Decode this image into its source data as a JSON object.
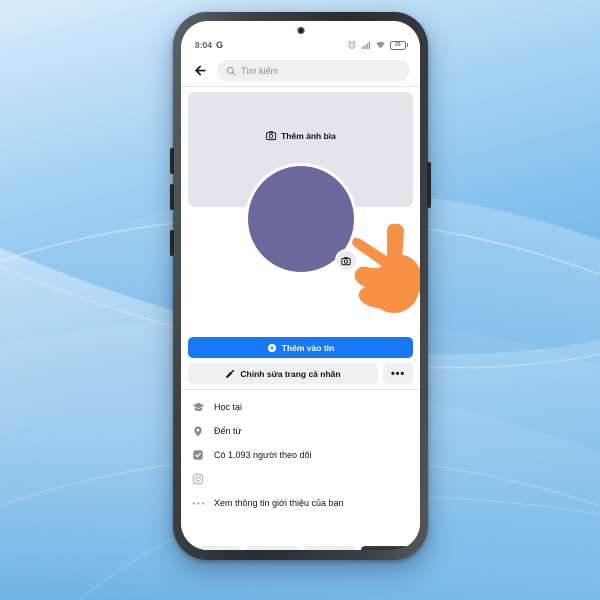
{
  "scene": {
    "description": "Android phone mockup on light blue abstract wallpaper showing a Facebook profile setup screen in Vietnamese",
    "wallpaper_colors": [
      "#cfe6fa",
      "#8ec5ef",
      "#63b0e8",
      "#4aa3e4"
    ]
  },
  "statusbar": {
    "time": "8:04",
    "network_label": "G",
    "icons": [
      "alarm-icon",
      "signal-icon",
      "wifi-icon",
      "battery-icon"
    ],
    "battery_level": "25"
  },
  "search": {
    "back_icon": "arrow-left-icon",
    "search_icon": "search-icon",
    "placeholder": "Tìm kiếm"
  },
  "cover": {
    "camera_icon": "camera-icon",
    "label": "Thêm ảnh bìa",
    "background_color": "#e3e5ea"
  },
  "avatar": {
    "color": "#6a699b",
    "badge_icon": "camera-icon"
  },
  "actions": {
    "story": {
      "icon": "plus-circle-icon",
      "label": "Thêm vào tin",
      "color": "#1877f2"
    },
    "edit": {
      "icon": "pencil-icon",
      "label": "Chỉnh sửa trang cá nhân"
    },
    "more": {
      "label": "•••"
    }
  },
  "info_rows": [
    {
      "icon": "graduation-cap-icon",
      "label": "Học tại"
    },
    {
      "icon": "location-pin-icon",
      "label": "Đến từ"
    },
    {
      "icon": "followers-icon",
      "label": "Có 1.093 người theo dõi"
    },
    {
      "icon": "instagram-icon",
      "label": ""
    },
    {
      "icon": "ellipsis-icon",
      "label": "Xem thông tin giới thiệu của bạn"
    }
  ],
  "annotation": {
    "hand_icon": "pointing-hand-icon",
    "hand_color": "#f79244",
    "points_at": "Thêm ảnh bìa"
  }
}
